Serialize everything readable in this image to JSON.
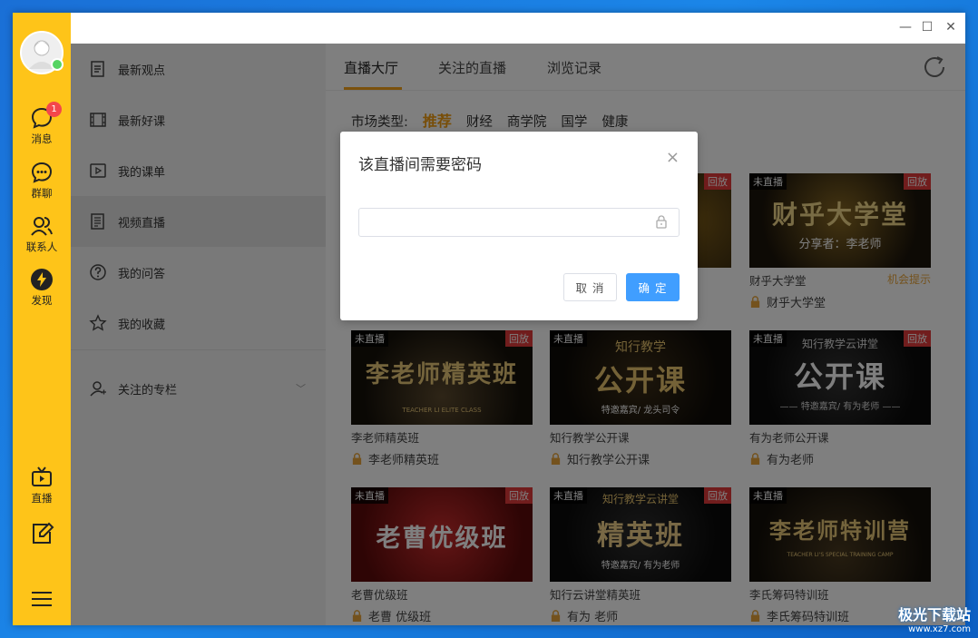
{
  "window": {
    "controls": {
      "minimize": "—",
      "maximize": "☐",
      "close": "✕"
    }
  },
  "leftbar": {
    "items": [
      {
        "label": "消息",
        "badge": "1"
      },
      {
        "label": "群聊"
      },
      {
        "label": "联系人"
      },
      {
        "label": "发现"
      }
    ],
    "bottom_items": [
      {
        "label": "直播"
      },
      {
        "label": ""
      }
    ]
  },
  "sidemenu": {
    "items": [
      {
        "label": "最新观点"
      },
      {
        "label": "最新好课"
      },
      {
        "label": "我的课单"
      },
      {
        "label": "视频直播"
      },
      {
        "label": "我的问答"
      },
      {
        "label": "我的收藏"
      },
      {
        "label": "关注的专栏"
      }
    ]
  },
  "main": {
    "tabs": [
      {
        "label": "直播大厅"
      },
      {
        "label": "关注的直播"
      },
      {
        "label": "浏览记录"
      }
    ],
    "filter": {
      "label": "市场类型:",
      "options": [
        "推荐",
        "财经",
        "商学院",
        "国学",
        "健康"
      ]
    },
    "cards": [
      {
        "tag_left": "",
        "tag_right": "回放",
        "title": "",
        "sub": "",
        "cap": "",
        "name": "",
        "hint": "",
        "owner": ""
      },
      {
        "tag_left": "",
        "tag_right": "回放",
        "title": "",
        "sub": "",
        "cap": "",
        "name": "",
        "hint": "",
        "owner": ""
      },
      {
        "tag_left": "未直播",
        "tag_right": "回放",
        "title": "财乎大学堂",
        "sub": "",
        "cap": "分享者：李老师",
        "name": "财乎大学堂",
        "hint": "机会提示",
        "owner": "财乎大学堂"
      },
      {
        "tag_left": "未直播",
        "tag_right": "回放",
        "title": "李老师精英班",
        "sub": "",
        "cap": "TEACHER LI ELITE CLASS",
        "name": "李老师精英班",
        "hint": "",
        "owner": "李老师精英班"
      },
      {
        "tag_left": "未直播",
        "tag_right": "",
        "title": "公开课",
        "sub": "知行教学",
        "cap": "特邀嘉宾/ 龙头司令",
        "name": "知行教学公开课",
        "hint": "",
        "owner": "知行教学公开课"
      },
      {
        "tag_left": "未直播",
        "tag_right": "回放",
        "title": "公开课",
        "sub": "知行教学云讲堂",
        "cap": "—— 特邀嘉宾/ 有为老师 ——",
        "name": "有为老师公开课",
        "hint": "",
        "owner": "有为老师"
      },
      {
        "tag_left": "未直播",
        "tag_right": "回放",
        "title": "老曹优级班",
        "sub": "",
        "cap": "",
        "name": "老曹优级班",
        "hint": "",
        "owner": "老曹 优级班"
      },
      {
        "tag_left": "未直播",
        "tag_right": "回放",
        "title": "精英班",
        "sub": "知行教学云讲堂",
        "cap": "特邀嘉宾/ 有为老师",
        "name": "知行云讲堂精英班",
        "hint": "",
        "owner": "有为 老师"
      },
      {
        "tag_left": "未直播",
        "tag_right": "",
        "title": "李老师特训营",
        "sub": "",
        "cap": "TEACHER LI'S SPECIAL TRAINING CAMP",
        "name": "李氏筹码特训班",
        "hint": "",
        "owner": "李氏筹码特训班"
      }
    ]
  },
  "dialog": {
    "title": "该直播间需要密码",
    "close": "×",
    "password_value": "",
    "password_placeholder": "",
    "cancel_label": "取 消",
    "ok_label": "确 定"
  },
  "watermark": {
    "line1": "极光下载站",
    "line2": "www.xz7.com"
  },
  "colors": {
    "accent": "#fec419",
    "primary_button": "#409eff",
    "filter_active": "#f09c12",
    "tab_underline": "#f7a21b",
    "replay_tag": "#e23b3b"
  }
}
